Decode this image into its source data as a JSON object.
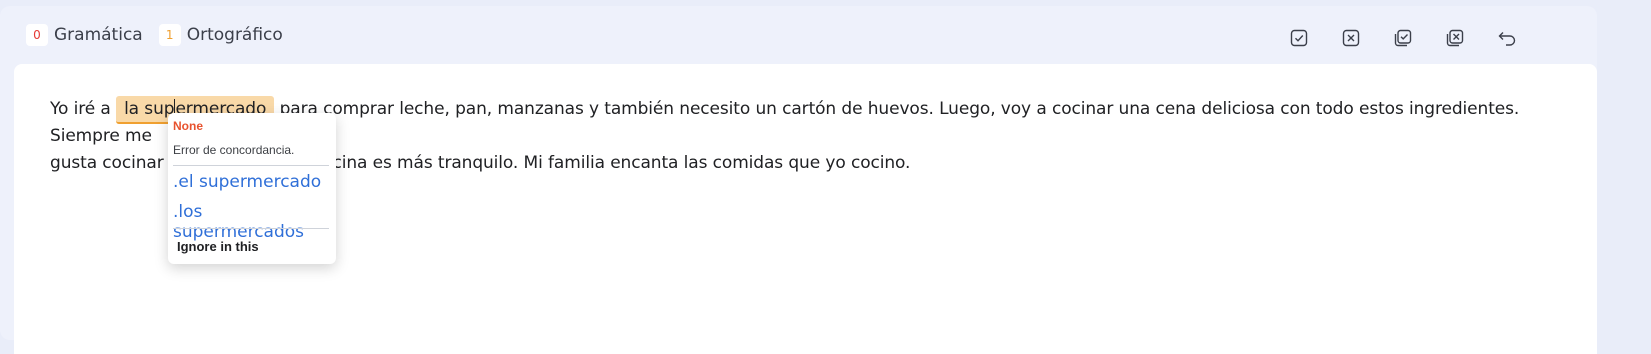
{
  "header": {
    "grammar": {
      "count": "0",
      "label": "Gramática"
    },
    "spelling": {
      "count": "1",
      "label": "Ortográfico"
    }
  },
  "toolbar": {
    "icons": [
      "accept-icon",
      "reject-icon",
      "accept-all-icon",
      "reject-all-icon",
      "undo-icon"
    ]
  },
  "editor": {
    "before": "Yo iré a ",
    "error_part1": "la sup",
    "error_part2": "ermercado",
    "line1_after": " para comprar leche, pan, manzanas y también necesito un cartón de huevos. Luego, voy a cocinar una cena deliciosa con todo estos ingredientes. Siempre me",
    "line2_start": "gusta cocinar e",
    "line2_rest": "a cocina es más tranquilo. Mi familia encanta las comidas que yo cocino."
  },
  "popup": {
    "title": "None",
    "message": "Error de concordancia.",
    "suggestions": [
      ".el supermercado",
      ".los supermercados"
    ],
    "ignore": "Ignore in this"
  },
  "colors": {
    "error_highlight": "#f9d9a8",
    "suggestion": "#2f6fd8",
    "title_red": "#e8532f"
  }
}
